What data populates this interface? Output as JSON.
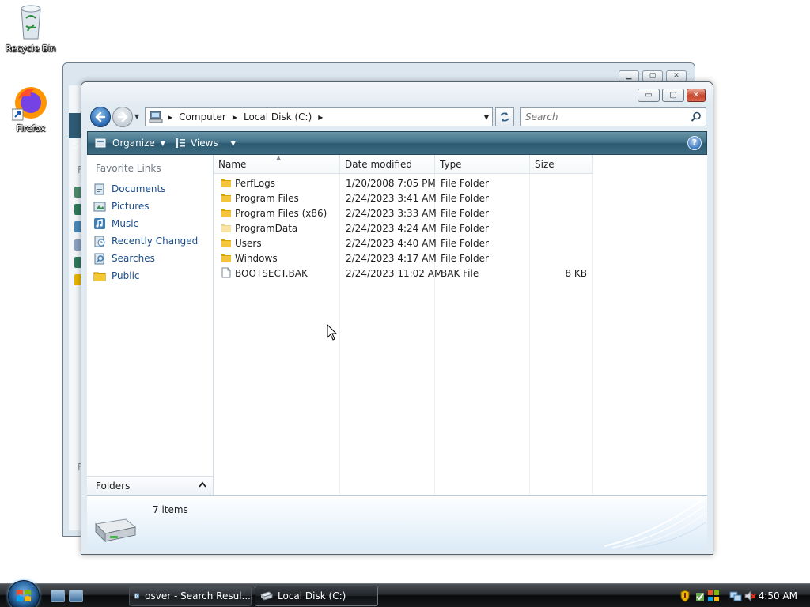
{
  "desktop": {
    "icons": [
      {
        "label": "Recycle Bin",
        "icon": "recycle-bin-icon"
      },
      {
        "label": "Firefox",
        "icon": "firefox-icon"
      }
    ]
  },
  "background_window": {
    "partial_text": [
      "Se",
      "F",
      "F"
    ]
  },
  "window": {
    "controls": {
      "minimize": "▭",
      "maximize": "▢",
      "close": "✕"
    },
    "address": {
      "crumbs": [
        "Computer",
        "Local Disk (C:)"
      ]
    },
    "search": {
      "placeholder": "Search"
    },
    "toolbar": {
      "organize_label": "Organize",
      "views_label": "Views",
      "help": "?"
    },
    "nav": {
      "title": "Favorite Links",
      "items": [
        {
          "label": "Documents",
          "icon": "documents-icon"
        },
        {
          "label": "Pictures",
          "icon": "pictures-icon"
        },
        {
          "label": "Music",
          "icon": "music-icon"
        },
        {
          "label": "Recently Changed",
          "icon": "recently-changed-icon"
        },
        {
          "label": "Searches",
          "icon": "searches-icon"
        },
        {
          "label": "Public",
          "icon": "public-folder-icon"
        }
      ],
      "folders_label": "Folders"
    },
    "columns": {
      "name": "Name",
      "date": "Date modified",
      "type": "Type",
      "size": "Size"
    },
    "files": [
      {
        "name": "PerfLogs",
        "date": "1/20/2008 7:05 PM",
        "type": "File Folder",
        "size": "",
        "icon": "folder-icon"
      },
      {
        "name": "Program Files",
        "date": "2/24/2023 3:41 AM",
        "type": "File Folder",
        "size": "",
        "icon": "folder-icon"
      },
      {
        "name": "Program Files (x86)",
        "date": "2/24/2023 3:33 AM",
        "type": "File Folder",
        "size": "",
        "icon": "folder-icon"
      },
      {
        "name": "ProgramData",
        "date": "2/24/2023 4:24 AM",
        "type": "File Folder",
        "size": "",
        "icon": "hidden-folder-icon"
      },
      {
        "name": "Users",
        "date": "2/24/2023 4:40 AM",
        "type": "File Folder",
        "size": "",
        "icon": "folder-icon"
      },
      {
        "name": "Windows",
        "date": "2/24/2023 4:17 AM",
        "type": "File Folder",
        "size": "",
        "icon": "folder-icon"
      },
      {
        "name": "BOOTSECT.BAK",
        "date": "2/24/2023 11:02 AM",
        "type": "BAK File",
        "size": "8 KB",
        "icon": "file-icon"
      }
    ],
    "details": {
      "item_count": "7 items"
    }
  },
  "taskbar": {
    "buttons": [
      {
        "label": "osver - Search Resul...",
        "icon": "search-results-icon"
      },
      {
        "label": "Local Disk (C:)",
        "icon": "drive-icon"
      }
    ],
    "clock": "4:50 AM"
  },
  "colors": {
    "toolbar": "#3f6f86",
    "link": "#1a4d8c",
    "folder": "#e8b400",
    "taskbar": "#17191b"
  }
}
